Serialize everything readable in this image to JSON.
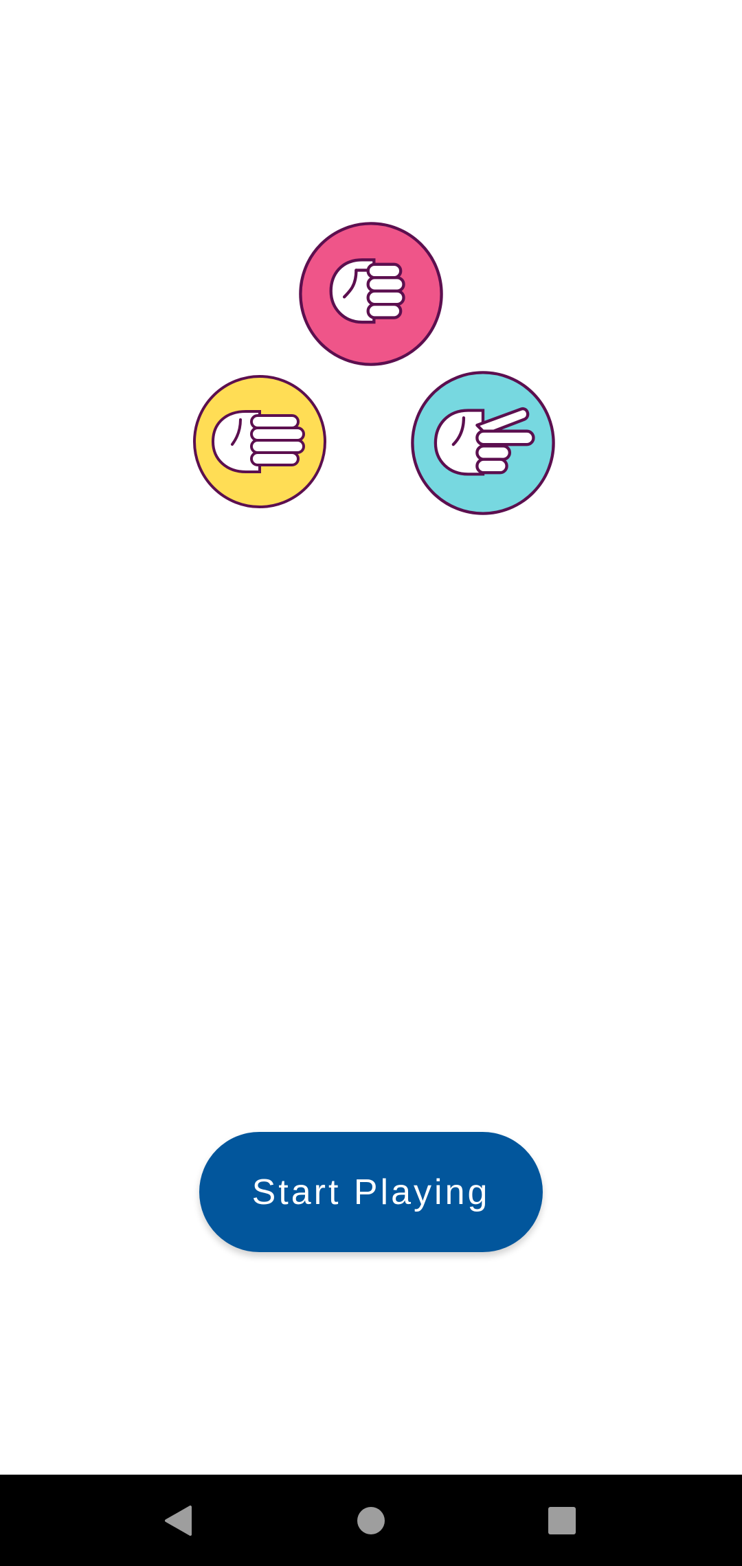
{
  "app": {
    "start_button_label": "Start Playing"
  },
  "logo": {
    "icons": [
      {
        "name": "rock-hand-icon",
        "color": "#ef5589"
      },
      {
        "name": "paper-hand-icon",
        "color": "#ffdd55"
      },
      {
        "name": "scissors-hand-icon",
        "color": "#77d8e0"
      }
    ],
    "outline_color": "#5c0f4f"
  },
  "colors": {
    "primary": "#02569c",
    "background": "#ffffff",
    "nav_bar": "#000000",
    "nav_icon": "#9e9e9e"
  },
  "nav": {
    "buttons": [
      "back-icon",
      "home-icon",
      "recents-icon"
    ]
  }
}
